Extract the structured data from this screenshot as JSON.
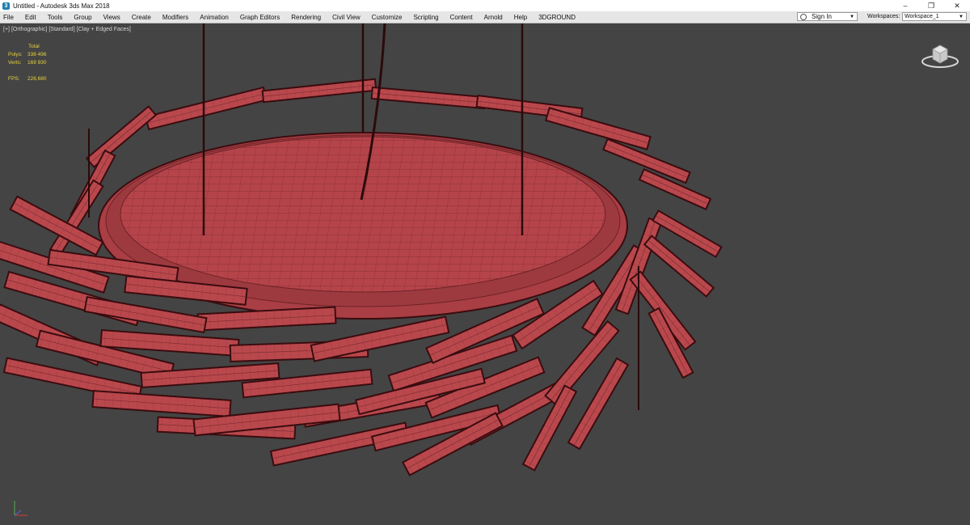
{
  "window": {
    "title": "Untitled - Autodesk 3ds Max 2018",
    "minimize": "–",
    "maximize": "❐",
    "close": "✕"
  },
  "menubar": {
    "items": [
      "File",
      "Edit",
      "Tools",
      "Group",
      "Views",
      "Create",
      "Modifiers",
      "Animation",
      "Graph Editors",
      "Rendering",
      "Civil View",
      "Customize",
      "Scripting",
      "Content",
      "Arnold",
      "Help",
      "3DGROUND"
    ],
    "sign_in": "Sign In",
    "workspaces_label": "Workspaces:",
    "workspace_value": "Workspace_1"
  },
  "viewport": {
    "label": [
      "[+]",
      "[Orthographic]",
      "[Standard]",
      "[Clay + Edged Faces]"
    ],
    "stats": {
      "header": "Total",
      "polys_label": "Polys:",
      "polys_value": "338 496",
      "verts_label": "Verts:",
      "verts_value": "169 930",
      "fps_label": "FPS:",
      "fps_value": "226,680"
    },
    "viewcube_icon": "viewcube-icon",
    "axis_icon": "axis-tripod-icon",
    "colors": {
      "background": "#444444",
      "model_fill": "#b5444a",
      "model_edge": "#3a0c0f",
      "stats_text": "#e8d23a"
    }
  }
}
